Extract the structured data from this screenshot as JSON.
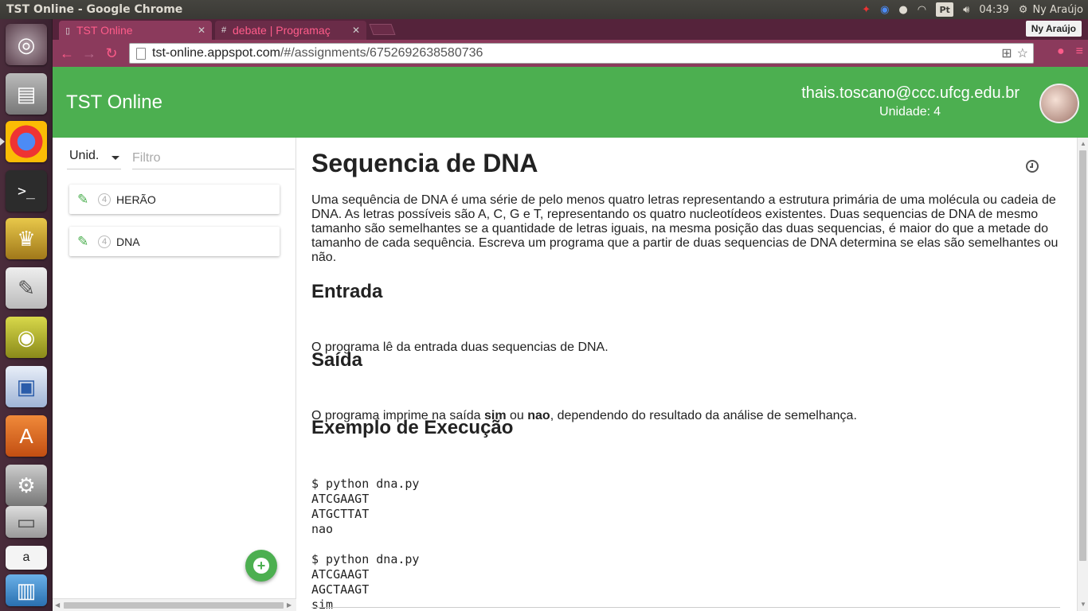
{
  "os": {
    "window_title": "TST Online - Google Chrome",
    "clock": "04:39",
    "user_name": "Ny Araújo",
    "keyboard_layout": "Pt"
  },
  "browser": {
    "tabs": [
      {
        "label": "TST Online",
        "active": true
      },
      {
        "label": "debate | Programaç",
        "active": false
      }
    ],
    "profile_name": "Ny Araújo",
    "url_host": "tst-online.appspot.com",
    "url_path": "/#/assignments/6752692638580736"
  },
  "app": {
    "title": "TST Online",
    "user_email": "thais.toscano@ccc.ufcg.edu.br",
    "unit_label": "Unidade:",
    "unit_value": "4"
  },
  "sidebar": {
    "unit_select": "Unid.",
    "filter_placeholder": "Filtro",
    "tasks": [
      {
        "unit": "4",
        "name": "HERÃO"
      },
      {
        "unit": "4",
        "name": "DNA"
      }
    ]
  },
  "assignment": {
    "title": "Sequencia de DNA",
    "description": "Uma sequência de DNA é uma série de pelo menos quatro letras representando a estrutura primária de uma molécula ou cadeia de DNA. As letras possíveis são A, C, G e T, representando os quatro nucleotídeos existentes. Duas sequencias de DNA de mesmo tamanho são semelhantes se a quantidade de letras iguais, na mesma posição das duas sequencias, é maior do que a metade do tamanho de cada sequência. Escreva um programa que a partir de duas sequencias de DNA determina se elas são semelhantes ou não.",
    "input_heading": "Entrada",
    "input_text": "O programa lê da entrada duas sequencias de DNA.",
    "output_heading": "Saída",
    "output_prefix": "O programa imprime na saída ",
    "output_sim": "sim",
    "output_or": " ou ",
    "output_nao": "nao",
    "output_suffix": ", dependendo do resultado da análise de semelhança.",
    "example_heading": "Exemplo de Execução",
    "example_1": "$ python dna.py\nATCGAAGT\nATGCTTAT\nnao",
    "example_2": "$ python dna.py\nATCGAAGT\nAGCTAAGT\nsim"
  },
  "colors": {
    "header_green": "#4caf50",
    "chrome_frame": "#8b3a5c",
    "tab_text": "#ff5c8a"
  }
}
